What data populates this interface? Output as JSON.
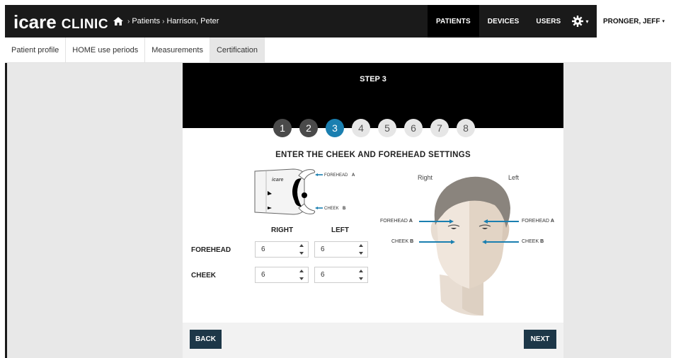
{
  "brand": {
    "logo_main": "icare",
    "logo_sub": "CLINIC"
  },
  "breadcrumb": {
    "items": [
      "Patients",
      "Harrison, Peter"
    ],
    "separator": "›"
  },
  "nav": {
    "patients": "PATIENTS",
    "devices": "DEVICES",
    "users": "USERS"
  },
  "user": {
    "name": "PRONGER, JEFF"
  },
  "tabs": [
    {
      "label": "Patient profile",
      "active": false
    },
    {
      "label": "HOME use periods",
      "active": false
    },
    {
      "label": "Measurements",
      "active": false
    },
    {
      "label": "Certification",
      "active": true
    }
  ],
  "wizard": {
    "title": "STEP 3",
    "current_step": 3,
    "steps": [
      "1",
      "2",
      "3",
      "4",
      "5",
      "6",
      "7",
      "8"
    ],
    "instruction": "ENTER THE CHEEK AND FOREHEAD SETTINGS"
  },
  "device_diagram": {
    "brand_text": "icare",
    "forehead_label": "FOREHEAD",
    "forehead_letter": "A",
    "cheek_label": "CHEEK",
    "cheek_letter": "B"
  },
  "form": {
    "col_right": "RIGHT",
    "col_left": "LEFT",
    "row_forehead": "FOREHEAD",
    "row_cheek": "CHEEK",
    "forehead_right": "6",
    "forehead_left": "6",
    "cheek_right": "6",
    "cheek_left": "6"
  },
  "face_diagram": {
    "right_label": "Right",
    "left_label": "Left",
    "forehead_label": "FOREHEAD",
    "forehead_letter": "A",
    "cheek_label": "CHEEK",
    "cheek_letter": "B"
  },
  "buttons": {
    "back": "BACK",
    "next": "NEXT"
  },
  "colors": {
    "accent": "#1a7fb0",
    "button": "#1d3748",
    "topbar": "#1a1a1a"
  }
}
